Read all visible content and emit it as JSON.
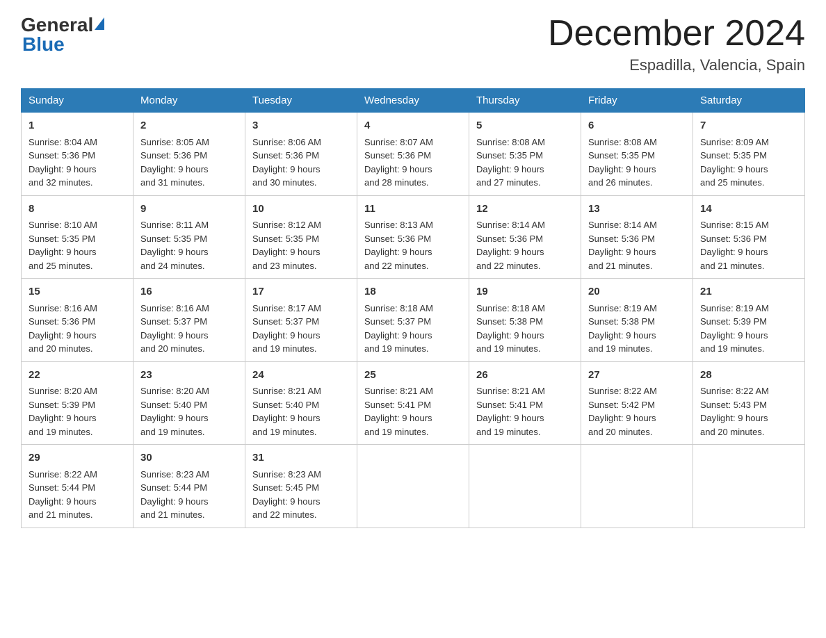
{
  "logo": {
    "general": "General",
    "blue": "Blue"
  },
  "title": "December 2024",
  "location": "Espadilla, Valencia, Spain",
  "weekdays": [
    "Sunday",
    "Monday",
    "Tuesday",
    "Wednesday",
    "Thursday",
    "Friday",
    "Saturday"
  ],
  "weeks": [
    [
      {
        "day": "1",
        "sunrise": "8:04 AM",
        "sunset": "5:36 PM",
        "daylight": "9 hours and 32 minutes."
      },
      {
        "day": "2",
        "sunrise": "8:05 AM",
        "sunset": "5:36 PM",
        "daylight": "9 hours and 31 minutes."
      },
      {
        "day": "3",
        "sunrise": "8:06 AM",
        "sunset": "5:36 PM",
        "daylight": "9 hours and 30 minutes."
      },
      {
        "day": "4",
        "sunrise": "8:07 AM",
        "sunset": "5:36 PM",
        "daylight": "9 hours and 28 minutes."
      },
      {
        "day": "5",
        "sunrise": "8:08 AM",
        "sunset": "5:35 PM",
        "daylight": "9 hours and 27 minutes."
      },
      {
        "day": "6",
        "sunrise": "8:08 AM",
        "sunset": "5:35 PM",
        "daylight": "9 hours and 26 minutes."
      },
      {
        "day": "7",
        "sunrise": "8:09 AM",
        "sunset": "5:35 PM",
        "daylight": "9 hours and 25 minutes."
      }
    ],
    [
      {
        "day": "8",
        "sunrise": "8:10 AM",
        "sunset": "5:35 PM",
        "daylight": "9 hours and 25 minutes."
      },
      {
        "day": "9",
        "sunrise": "8:11 AM",
        "sunset": "5:35 PM",
        "daylight": "9 hours and 24 minutes."
      },
      {
        "day": "10",
        "sunrise": "8:12 AM",
        "sunset": "5:35 PM",
        "daylight": "9 hours and 23 minutes."
      },
      {
        "day": "11",
        "sunrise": "8:13 AM",
        "sunset": "5:36 PM",
        "daylight": "9 hours and 22 minutes."
      },
      {
        "day": "12",
        "sunrise": "8:14 AM",
        "sunset": "5:36 PM",
        "daylight": "9 hours and 22 minutes."
      },
      {
        "day": "13",
        "sunrise": "8:14 AM",
        "sunset": "5:36 PM",
        "daylight": "9 hours and 21 minutes."
      },
      {
        "day": "14",
        "sunrise": "8:15 AM",
        "sunset": "5:36 PM",
        "daylight": "9 hours and 21 minutes."
      }
    ],
    [
      {
        "day": "15",
        "sunrise": "8:16 AM",
        "sunset": "5:36 PM",
        "daylight": "9 hours and 20 minutes."
      },
      {
        "day": "16",
        "sunrise": "8:16 AM",
        "sunset": "5:37 PM",
        "daylight": "9 hours and 20 minutes."
      },
      {
        "day": "17",
        "sunrise": "8:17 AM",
        "sunset": "5:37 PM",
        "daylight": "9 hours and 19 minutes."
      },
      {
        "day": "18",
        "sunrise": "8:18 AM",
        "sunset": "5:37 PM",
        "daylight": "9 hours and 19 minutes."
      },
      {
        "day": "19",
        "sunrise": "8:18 AM",
        "sunset": "5:38 PM",
        "daylight": "9 hours and 19 minutes."
      },
      {
        "day": "20",
        "sunrise": "8:19 AM",
        "sunset": "5:38 PM",
        "daylight": "9 hours and 19 minutes."
      },
      {
        "day": "21",
        "sunrise": "8:19 AM",
        "sunset": "5:39 PM",
        "daylight": "9 hours and 19 minutes."
      }
    ],
    [
      {
        "day": "22",
        "sunrise": "8:20 AM",
        "sunset": "5:39 PM",
        "daylight": "9 hours and 19 minutes."
      },
      {
        "day": "23",
        "sunrise": "8:20 AM",
        "sunset": "5:40 PM",
        "daylight": "9 hours and 19 minutes."
      },
      {
        "day": "24",
        "sunrise": "8:21 AM",
        "sunset": "5:40 PM",
        "daylight": "9 hours and 19 minutes."
      },
      {
        "day": "25",
        "sunrise": "8:21 AM",
        "sunset": "5:41 PM",
        "daylight": "9 hours and 19 minutes."
      },
      {
        "day": "26",
        "sunrise": "8:21 AM",
        "sunset": "5:41 PM",
        "daylight": "9 hours and 19 minutes."
      },
      {
        "day": "27",
        "sunrise": "8:22 AM",
        "sunset": "5:42 PM",
        "daylight": "9 hours and 20 minutes."
      },
      {
        "day": "28",
        "sunrise": "8:22 AM",
        "sunset": "5:43 PM",
        "daylight": "9 hours and 20 minutes."
      }
    ],
    [
      {
        "day": "29",
        "sunrise": "8:22 AM",
        "sunset": "5:44 PM",
        "daylight": "9 hours and 21 minutes."
      },
      {
        "day": "30",
        "sunrise": "8:23 AM",
        "sunset": "5:44 PM",
        "daylight": "9 hours and 21 minutes."
      },
      {
        "day": "31",
        "sunrise": "8:23 AM",
        "sunset": "5:45 PM",
        "daylight": "9 hours and 22 minutes."
      },
      null,
      null,
      null,
      null
    ]
  ],
  "labels": {
    "sunrise": "Sunrise:",
    "sunset": "Sunset:",
    "daylight": "Daylight:"
  }
}
